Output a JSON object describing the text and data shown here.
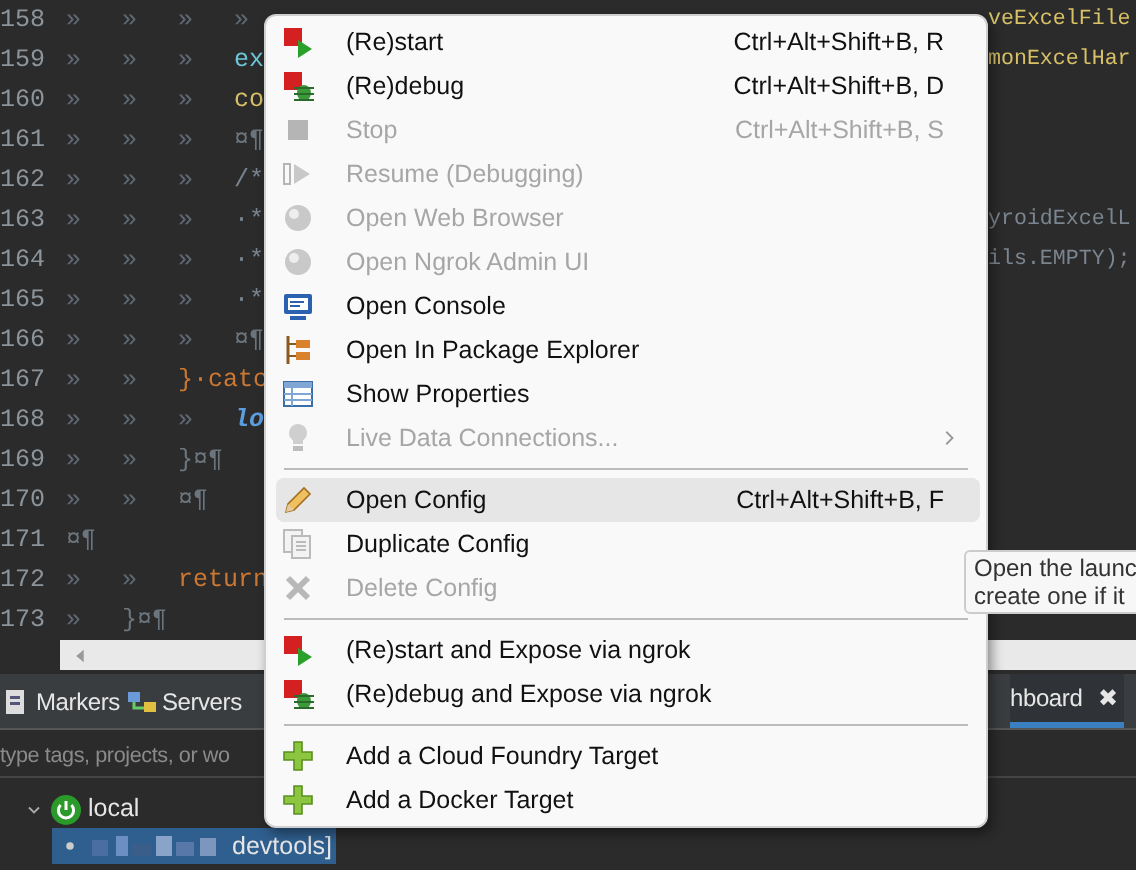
{
  "editor": {
    "lines": [
      {
        "number": "158",
        "marks": "»\t»\t»\t»",
        "tail": {
          "text": "veExcelFile",
          "kind": "field"
        }
      },
      {
        "number": "159",
        "marks": "»\t»\t»\t",
        "code": {
          "text": "ex",
          "kind": "identifier"
        },
        "tail": {
          "text": "monExcelHar",
          "kind": "field"
        }
      },
      {
        "number": "160",
        "marks": "»\t»\t»\t",
        "code": {
          "text": "co",
          "kind": "field"
        }
      },
      {
        "number": "161",
        "marks": "»\t»\t»\t",
        "code": {
          "text": "¤¶",
          "kind": "whitespace"
        }
      },
      {
        "number": "162",
        "marks": "»\t»\t»\t",
        "code": {
          "text": "/*",
          "kind": "comment"
        }
      },
      {
        "number": "163",
        "marks": "»\t»\t»\t",
        "code": {
          "text": "·*",
          "kind": "comment"
        },
        "tail": {
          "text": "yroidExcelL",
          "kind": "comment"
        }
      },
      {
        "number": "164",
        "marks": "»\t»\t»\t",
        "code": {
          "text": "·*",
          "kind": "comment"
        },
        "tail": {
          "text": "ils.EMPTY);",
          "kind": "comment"
        }
      },
      {
        "number": "165",
        "marks": "»\t»\t»\t",
        "code": {
          "text": "·*",
          "kind": "comment"
        }
      },
      {
        "number": "166",
        "marks": "»\t»\t»\t",
        "code": {
          "text": "¤¶",
          "kind": "whitespace"
        }
      },
      {
        "number": "167",
        "marks": "»\t»\t",
        "code": {
          "text": "}·catc",
          "kind": "keyword"
        }
      },
      {
        "number": "168",
        "marks": "»\t»\t»\t",
        "code": {
          "text": "lo",
          "kind": "static"
        }
      },
      {
        "number": "169",
        "marks": "»\t»\t",
        "code": {
          "text": "}¤¶",
          "kind": "whitespace"
        }
      },
      {
        "number": "170",
        "marks": "»\t»\t",
        "code": {
          "text": "¤¶",
          "kind": "whitespace"
        }
      },
      {
        "number": "171",
        "code": {
          "text": "¤¶",
          "kind": "whitespace"
        }
      },
      {
        "number": "172",
        "marks": "»\t»\t",
        "code": {
          "text": "return",
          "kind": "keyword"
        }
      },
      {
        "number": "173",
        "marks": "»\t",
        "code": {
          "text": "}¤¶",
          "kind": "whitespace"
        }
      }
    ]
  },
  "panel": {
    "tabs": [
      {
        "label": "Markers",
        "selected": false
      },
      {
        "label": "Servers",
        "selected": false
      },
      {
        "label": "hboard",
        "selected": true,
        "close": "✖"
      }
    ],
    "search": {
      "placeholder": "type tags, projects, or wo"
    },
    "tree": [
      {
        "label": "local",
        "expanded": true,
        "children": [
          {
            "label": "devtools]",
            "selected": true
          }
        ]
      }
    ]
  },
  "context_menu": {
    "items": [
      {
        "kind": "item",
        "label": "(Re)start",
        "shortcut": "Ctrl+Alt+Shift+B, R",
        "disabled": false,
        "selected": false
      },
      {
        "kind": "item",
        "label": "(Re)debug",
        "shortcut": "Ctrl+Alt+Shift+B, D",
        "disabled": false,
        "selected": false
      },
      {
        "kind": "item",
        "label": "Stop",
        "shortcut": "Ctrl+Alt+Shift+B, S",
        "disabled": true,
        "selected": false
      },
      {
        "kind": "item",
        "label": "Resume (Debugging)",
        "disabled": true,
        "selected": false
      },
      {
        "kind": "item",
        "label": "Open Web Browser",
        "disabled": true,
        "selected": false
      },
      {
        "kind": "item",
        "label": "Open Ngrok Admin UI",
        "disabled": true,
        "selected": false
      },
      {
        "kind": "item",
        "label": "Open Console",
        "disabled": false,
        "selected": false
      },
      {
        "kind": "item",
        "label": "Open In Package Explorer",
        "disabled": false,
        "selected": false
      },
      {
        "kind": "item",
        "label": "Show Properties",
        "disabled": false,
        "selected": false
      },
      {
        "kind": "item",
        "label": "Live Data Connections...",
        "disabled": true,
        "selected": false,
        "submenu": true
      },
      {
        "kind": "separator"
      },
      {
        "kind": "item",
        "label": "Open Config",
        "shortcut": "Ctrl+Alt+Shift+B, F",
        "disabled": false,
        "selected": true
      },
      {
        "kind": "item",
        "label": "Duplicate Config",
        "disabled": false,
        "selected": false
      },
      {
        "kind": "item",
        "label": "Delete Config",
        "disabled": true,
        "selected": false
      },
      {
        "kind": "separator"
      },
      {
        "kind": "item",
        "label": "(Re)start and Expose via ngrok",
        "disabled": false,
        "selected": false
      },
      {
        "kind": "item",
        "label": "(Re)debug and Expose via ngrok",
        "disabled": false,
        "selected": false
      },
      {
        "kind": "separator"
      },
      {
        "kind": "item",
        "label": "Add a Cloud Foundry Target",
        "disabled": false,
        "selected": false
      },
      {
        "kind": "item",
        "label": "Add a Docker Target",
        "disabled": false,
        "selected": false
      }
    ]
  },
  "tooltip": {
    "lines": [
      "Open the launc",
      "create one if it"
    ]
  }
}
